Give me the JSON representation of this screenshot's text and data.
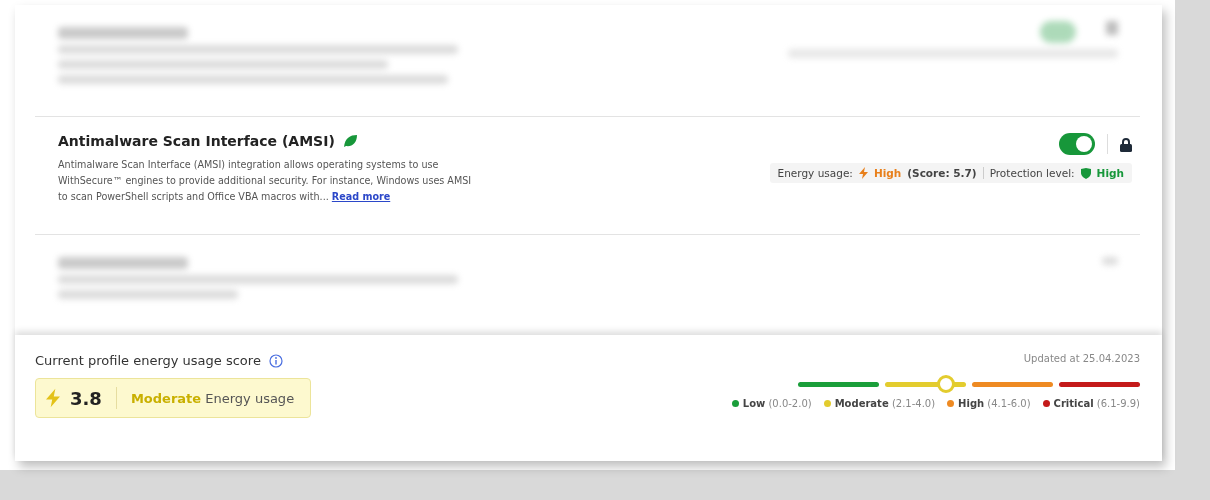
{
  "settings": [
    {
      "kind": "blurred"
    },
    {
      "kind": "setting",
      "title": "Antimalware Scan Interface (AMSI)",
      "description": "Antimalware Scan Interface (AMSI) integration allows operating systems to use WithSecure™ engines to provide additional security. For instance, Windows uses AMSI to scan PowerShell scripts and Office VBA macros with...",
      "link": "Read more",
      "on": true,
      "locked": true,
      "energy_label": "Energy usage:",
      "energy_value": "High",
      "energy_score": "(Score: 5.7)",
      "protection_label": "Protection level:",
      "protection_value": "High"
    },
    {
      "kind": "blurred-short"
    }
  ],
  "footer": {
    "title": "Current profile energy usage score",
    "updated": "Updated at 25.04.2023",
    "score": "3.8",
    "level_name": "Moderate",
    "level_suffix": "Energy usage",
    "legend": [
      {
        "name": "Low",
        "range": "(0.0-2.0)",
        "color": "#1a9e3a"
      },
      {
        "name": "Moderate",
        "range": "(2.1-4.0)",
        "color": "#e3cc2e"
      },
      {
        "name": "High",
        "range": "(4.1-6.0)",
        "color": "#ee8a22"
      },
      {
        "name": "Critical",
        "range": "(6.1-9.9)",
        "color": "#c41a1a"
      }
    ]
  }
}
